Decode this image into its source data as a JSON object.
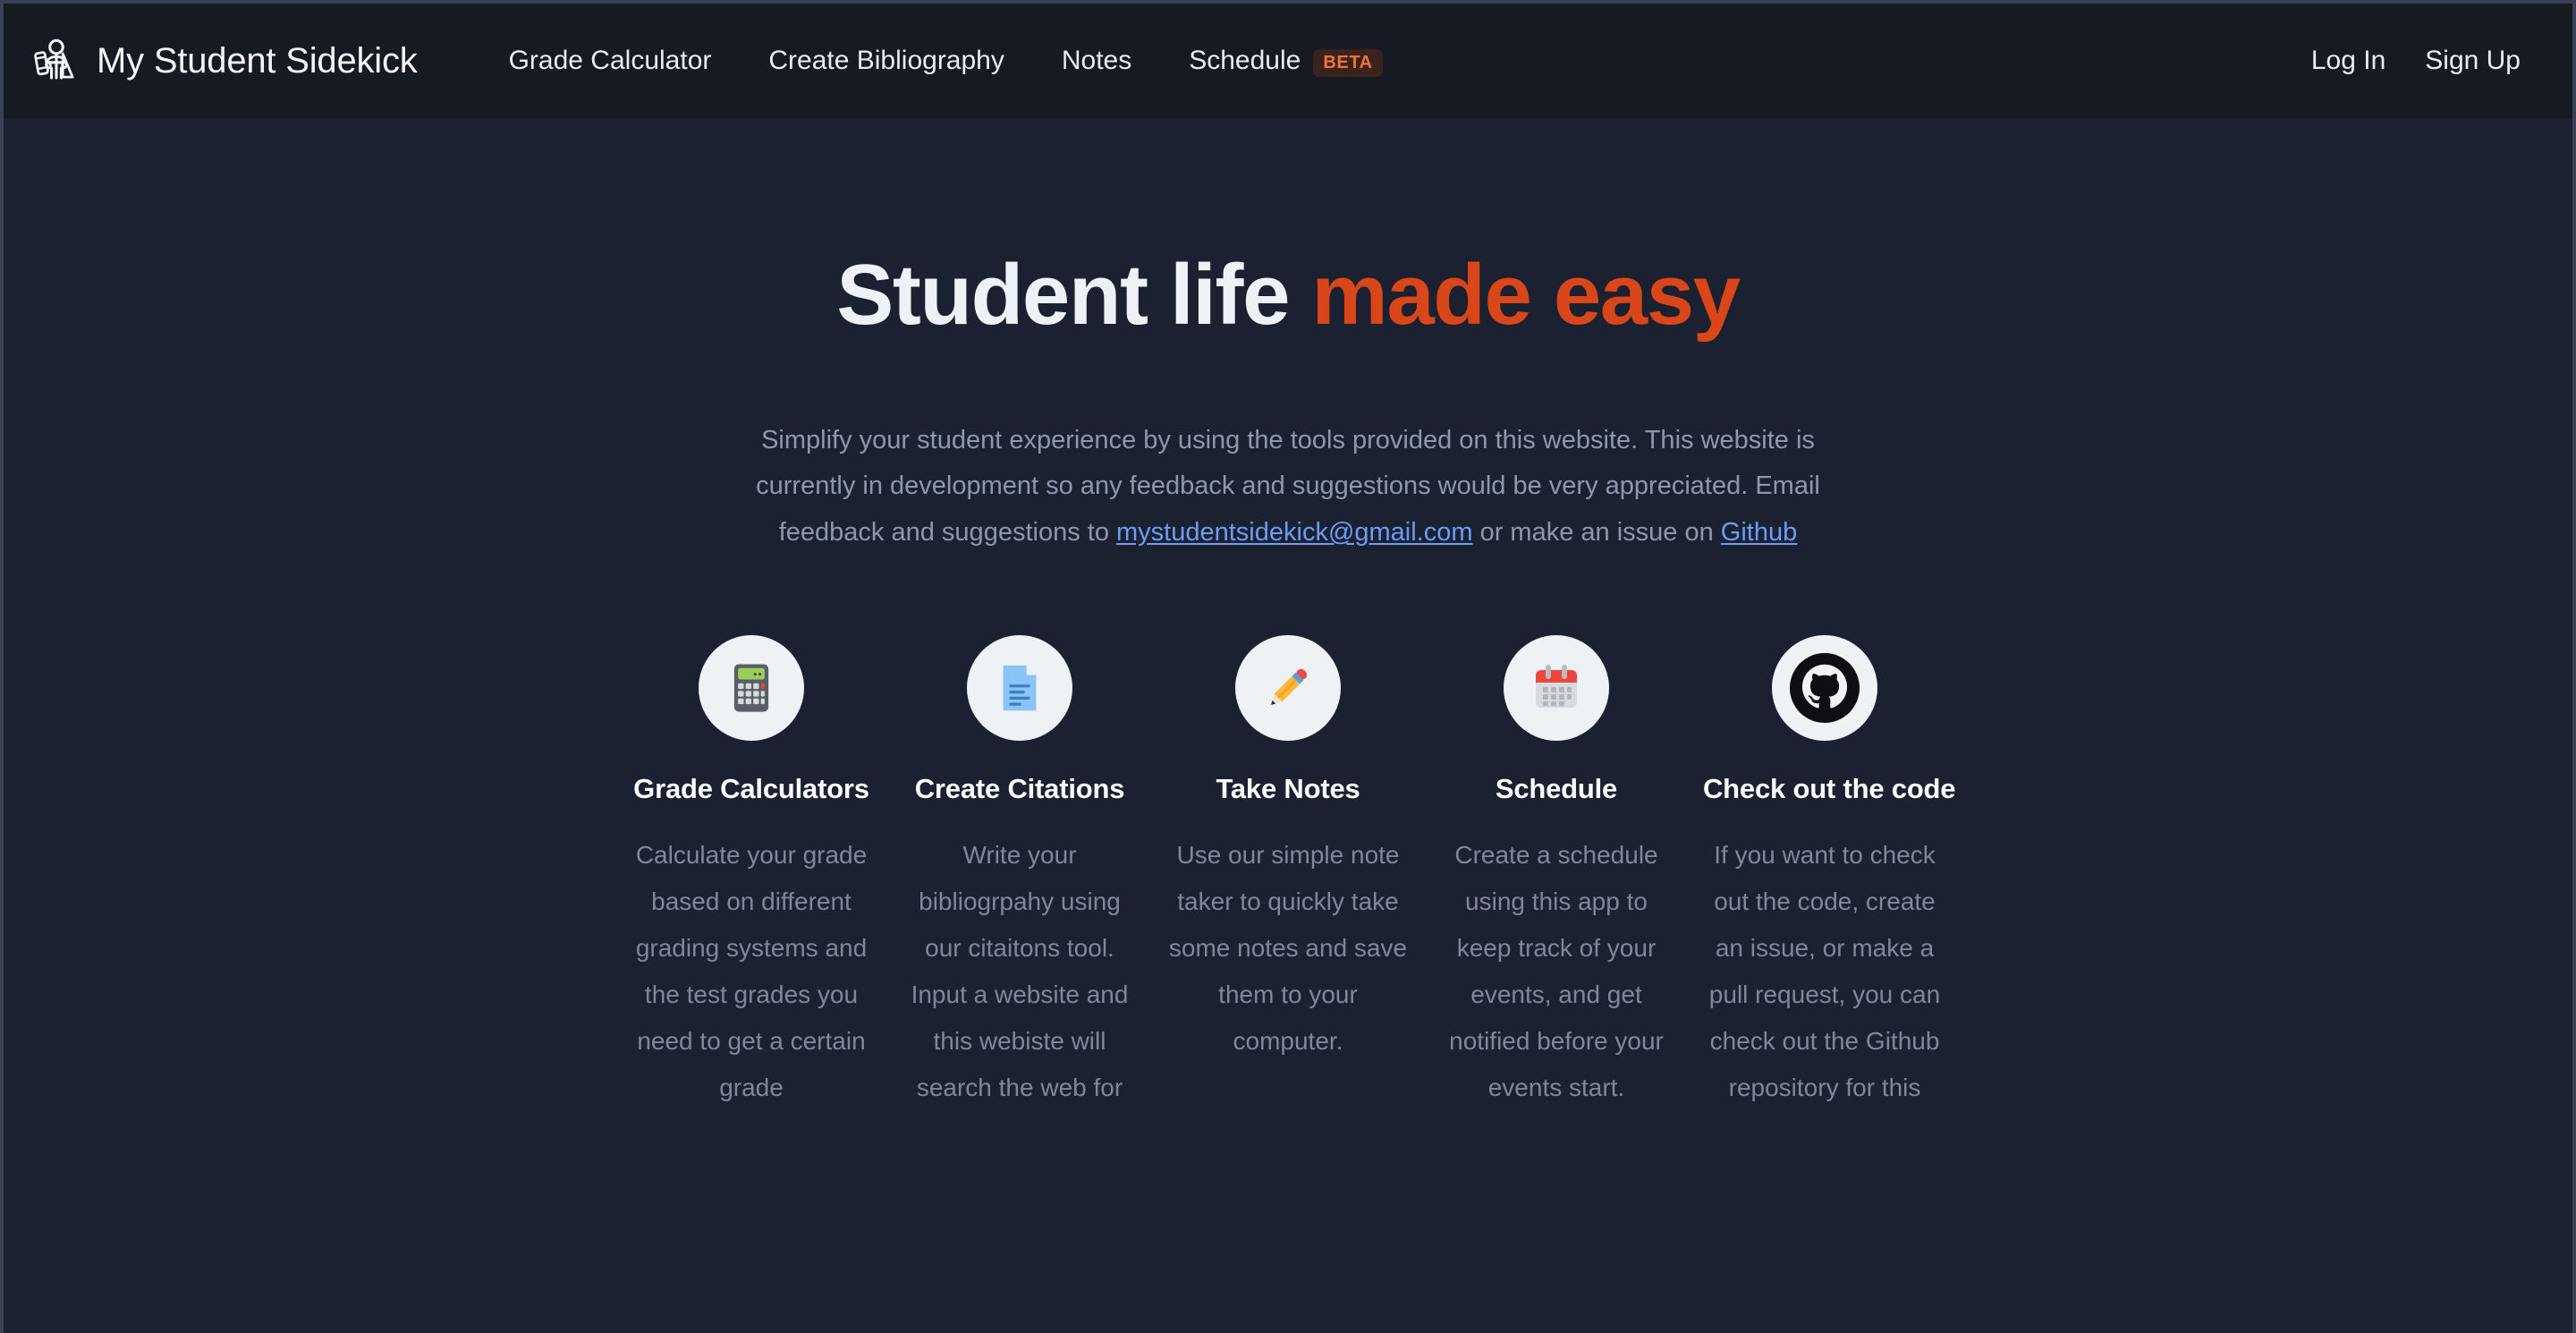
{
  "brand": {
    "name": "My Student Sidekick",
    "logo_icon": "student-sidekick-logo-icon"
  },
  "nav": {
    "links": [
      {
        "label": "Grade Calculator",
        "badge": null
      },
      {
        "label": "Create Bibliography",
        "badge": null
      },
      {
        "label": "Notes",
        "badge": null
      },
      {
        "label": "Schedule",
        "badge": "BETA"
      }
    ],
    "auth": [
      {
        "label": "Log In"
      },
      {
        "label": "Sign Up"
      }
    ]
  },
  "hero": {
    "title_plain": "Student life ",
    "title_accent": "made easy",
    "accent_color": "#d8461a",
    "paragraph_before_email": "Simplify your student experience by using the tools provided on this website. This website is currently in development so any feedback and suggestions would be very appreciated. Email feedback and suggestions to ",
    "email_link": "mystudentsidekick@gmail.com",
    "paragraph_between": " or make an issue on ",
    "github_link": "Github",
    "link_color": "#6d9cf4"
  },
  "features": [
    {
      "icon": "calculator-icon",
      "title": "Grade Calculators",
      "description": "Calculate your grade based on different grading systems and the test grades you need to get a certain grade"
    },
    {
      "icon": "document-icon",
      "title": "Create Citations",
      "description": "Write your bibliogrpahy using our citaitons tool. Input a website and this webiste will search the web for"
    },
    {
      "icon": "pencil-icon",
      "title": "Take Notes",
      "description": "Use our simple note taker to quickly take some notes and save them to your computer."
    },
    {
      "icon": "calendar-icon",
      "title": "Schedule",
      "description": "Create a schedule using this app to keep track of your events, and get notified before your events start."
    },
    {
      "icon": "github-icon",
      "title": "Check out the code",
      "description": "If you want to check out the code, create an issue, or make a pull request, you can check out the Github repository for this"
    }
  ]
}
